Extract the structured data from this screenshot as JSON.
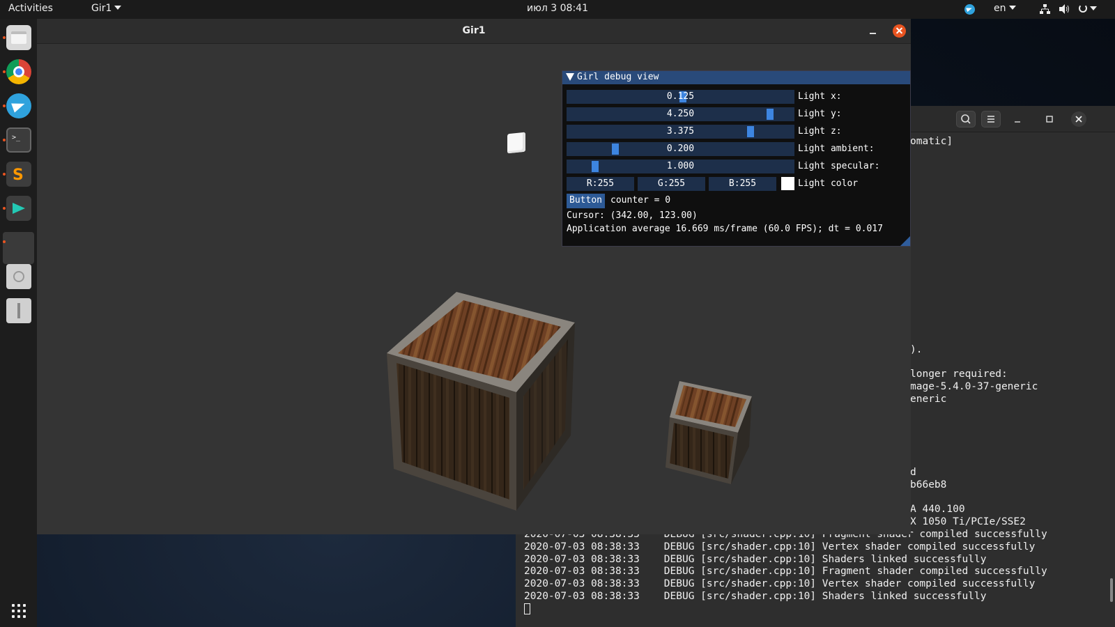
{
  "topbar": {
    "activities": "Activities",
    "app_menu": "Gir1",
    "clock": "июл 3  08:41",
    "language": "en"
  },
  "dock": {
    "items": [
      "files-icon",
      "chrome-icon",
      "telegram-icon",
      "terminal-icon",
      "sublime-text-icon",
      "vscode-icon",
      "active-app-icon",
      "optical-drive-icon",
      "usb-drive-icon"
    ],
    "show_apps": "show-applications-icon"
  },
  "window": {
    "title": "Gir1"
  },
  "debug_panel": {
    "title": "Girl debug view",
    "sliders": [
      {
        "label": "Light x:",
        "value": "0.125",
        "level": 0.51
      },
      {
        "label": "Light y:",
        "value": "4.250",
        "level": 0.91
      },
      {
        "label": "Light z:",
        "value": "3.375",
        "level": 0.82
      },
      {
        "label": "Light ambient:",
        "value": "0.200",
        "level": 0.2
      },
      {
        "label": "Light specular:",
        "value": "1.000",
        "level": 0.11
      }
    ],
    "color": {
      "r": "R:255",
      "g": "G:255",
      "b": "B:255",
      "label": "Light color",
      "swatch": "#ffffff"
    },
    "button_label": "Button",
    "counter_text": "counter = 0",
    "cursor_text": "Cursor: (342.00, 123.00)",
    "fps_text": "Application average 16.669 ms/frame (60.0 FPS); dt = 0.017"
  },
  "terminal": {
    "partial_lines": [
      "omatic]",
      ").",
      "longer required:",
      "mage-5.4.0-37-generic",
      "eneric",
      "d",
      "b66eb8",
      "A 440.100",
      "X 1050 Ti/PCIe/SSE2"
    ],
    "log_lines": [
      "2020-07-03 08:38:33    DEBUG [src/shader.cpp:10] Fragment shader compiled successfully",
      "2020-07-03 08:38:33    DEBUG [src/shader.cpp:10] Vertex shader compiled successfully",
      "2020-07-03 08:38:33    DEBUG [src/shader.cpp:10] Shaders linked successfully",
      "2020-07-03 08:38:33    DEBUG [src/shader.cpp:10] Fragment shader compiled successfully",
      "2020-07-03 08:38:33    DEBUG [src/shader.cpp:10] Vertex shader compiled successfully",
      "2020-07-03 08:38:33    DEBUG [src/shader.cpp:10] Shaders linked successfully"
    ]
  }
}
